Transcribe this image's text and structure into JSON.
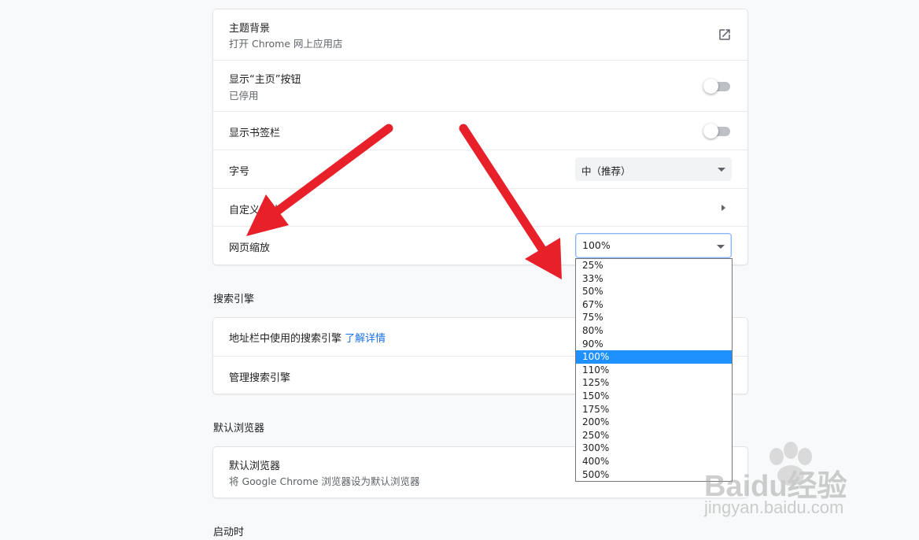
{
  "appearance": {
    "theme": {
      "title": "主题背景",
      "subtitle": "打开 Chrome 网上应用店",
      "icon": "open-in-new-icon"
    },
    "home_button": {
      "title": "显示“主页”按钮",
      "subtitle": "已停用",
      "enabled": false
    },
    "bookmarks_bar": {
      "title": "显示书签栏",
      "enabled": false
    },
    "font_size": {
      "title": "字号",
      "value": "中（推荐）"
    },
    "custom_fonts": {
      "title": "自定义字体"
    },
    "page_zoom": {
      "title": "网页缩放",
      "value": "100%",
      "options": [
        "25%",
        "33%",
        "50%",
        "67%",
        "75%",
        "80%",
        "90%",
        "100%",
        "110%",
        "125%",
        "150%",
        "175%",
        "200%",
        "250%",
        "300%",
        "400%",
        "500%"
      ],
      "selected_index": 7
    }
  },
  "search_engine": {
    "section_title": "搜索引擎",
    "address_bar": {
      "title": "地址栏中使用的搜索引擎",
      "link": "了解详情"
    },
    "manage": {
      "title": "管理搜索引擎"
    }
  },
  "default_browser": {
    "section_title": "默认浏览器",
    "title": "默认浏览器",
    "subtitle": "将 Google Chrome 浏览器设为默认浏览器"
  },
  "startup": {
    "section_title": "启动时"
  },
  "watermark": {
    "brand": "Baidu经验",
    "url": "jingyan.baidu.com"
  },
  "colors": {
    "arrow": "#e8202a",
    "selected_option": "#1e90ff",
    "link": "#1a73e8"
  }
}
